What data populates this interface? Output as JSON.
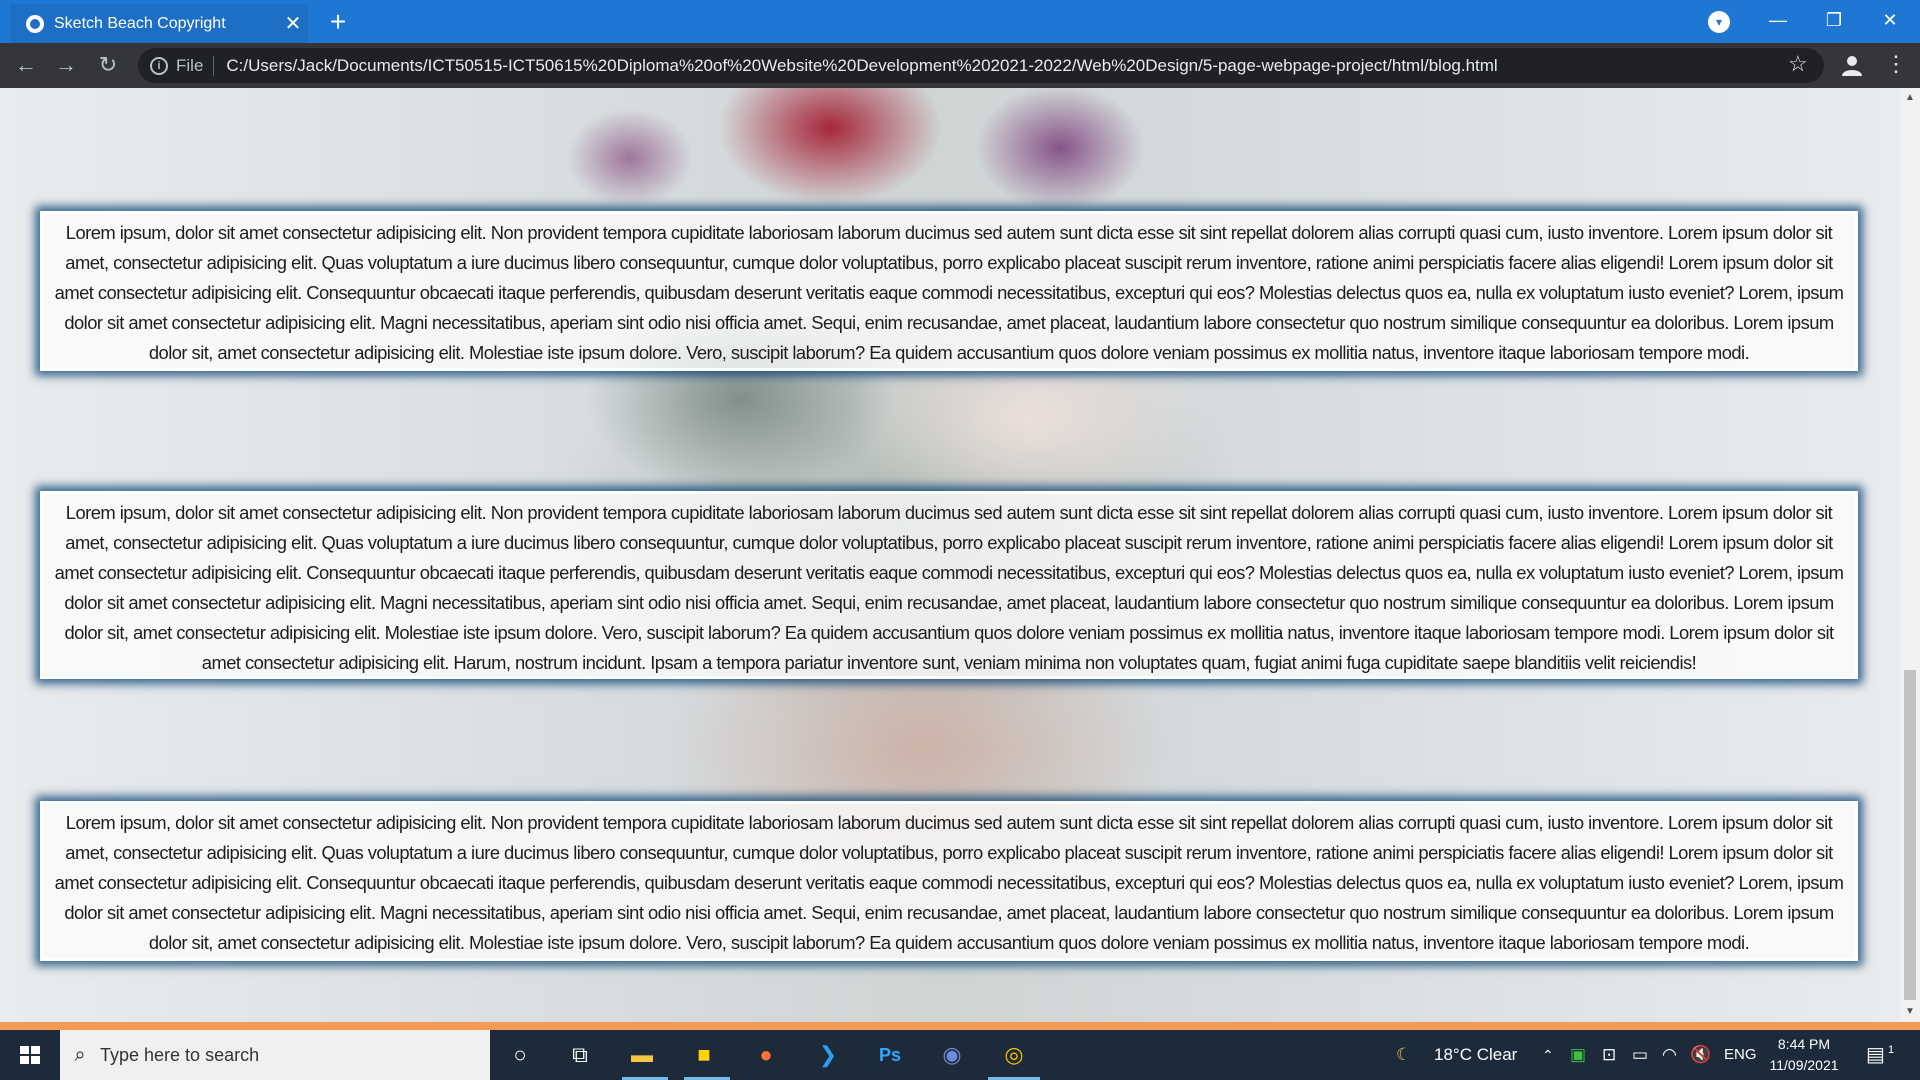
{
  "browser": {
    "tab_title": "Sketch Beach Copyright",
    "tab_close": "✕",
    "new_tab": "+",
    "scheme": "File",
    "url": "C:/Users/Jack/Documents/ICT50515-ICT50615%20Diploma%20of%20Website%20Development%202021-2022/Web%20Design/5-page-webpage-project/html/blog.html"
  },
  "content": {
    "paragraphs": [
      "Lorem ipsum, dolor sit amet consectetur adipisicing elit. Non provident tempora cupiditate laboriosam laborum ducimus sed autem sunt dicta esse sit sint repellat dolorem alias corrupti quasi cum, iusto inventore. Lorem ipsum dolor sit amet, consectetur adipisicing elit. Quas voluptatum a iure ducimus libero consequuntur, cumque dolor voluptatibus, porro explicabo placeat suscipit rerum inventore, ratione animi perspiciatis facere alias eligendi! Lorem ipsum dolor sit amet consectetur adipisicing elit. Consequuntur obcaecati itaque perferendis, quibusdam deserunt veritatis eaque commodi necessitatibus, excepturi qui eos? Molestias delectus quos ea, nulla ex voluptatum iusto eveniet? Lorem, ipsum dolor sit amet consectetur adipisicing elit. Magni necessitatibus, aperiam sint odio nisi officia amet. Sequi, enim recusandae, amet placeat, laudantium labore consectetur quo nostrum similique consequuntur ea doloribus. Lorem ipsum dolor sit, amet consectetur adipisicing elit. Molestiae iste ipsum dolore. Vero, suscipit laborum? Ea quidem accusantium quos dolore veniam possimus ex mollitia natus, inventore itaque laboriosam tempore modi.",
      "Lorem ipsum, dolor sit amet consectetur adipisicing elit. Non provident tempora cupiditate laboriosam laborum ducimus sed autem sunt dicta esse sit sint repellat dolorem alias corrupti quasi cum, iusto inventore. Lorem ipsum dolor sit amet, consectetur adipisicing elit. Quas voluptatum a iure ducimus libero consequuntur, cumque dolor voluptatibus, porro explicabo placeat suscipit rerum inventore, ratione animi perspiciatis facere alias eligendi! Lorem ipsum dolor sit amet consectetur adipisicing elit. Consequuntur obcaecati itaque perferendis, quibusdam deserunt veritatis eaque commodi necessitatibus, excepturi qui eos? Molestias delectus quos ea, nulla ex voluptatum iusto eveniet? Lorem, ipsum dolor sit amet consectetur adipisicing elit. Magni necessitatibus, aperiam sint odio nisi officia amet. Sequi, enim recusandae, amet placeat, laudantium labore consectetur quo nostrum similique consequuntur ea doloribus. Lorem ipsum dolor sit, amet consectetur adipisicing elit. Molestiae iste ipsum dolore. Vero, suscipit laborum? Ea quidem accusantium quos dolore veniam possimus ex mollitia natus, inventore itaque laboriosam tempore modi. Lorem ipsum dolor sit amet consectetur adipisicing elit. Harum, nostrum incidunt. Ipsam a tempora pariatur inventore sunt, veniam minima non voluptates quam, fugiat animi fuga cupiditate saepe blanditiis velit reiciendis!",
      "Lorem ipsum, dolor sit amet consectetur adipisicing elit. Non provident tempora cupiditate laboriosam laborum ducimus sed autem sunt dicta esse sit sint repellat dolorem alias corrupti quasi cum, iusto inventore. Lorem ipsum dolor sit amet, consectetur adipisicing elit. Quas voluptatum a iure ducimus libero consequuntur, cumque dolor voluptatibus, porro explicabo placeat suscipit rerum inventore, ratione animi perspiciatis facere alias eligendi! Lorem ipsum dolor sit amet consectetur adipisicing elit. Consequuntur obcaecati itaque perferendis, quibusdam deserunt veritatis eaque commodi necessitatibus, excepturi qui eos? Molestias delectus quos ea, nulla ex voluptatum iusto eveniet? Lorem, ipsum dolor sit amet consectetur adipisicing elit. Magni necessitatibus, aperiam sint odio nisi officia amet. Sequi, enim recusandae, amet placeat, laudantium labore consectetur quo nostrum similique consequuntur ea doloribus. Lorem ipsum dolor sit, amet consectetur adipisicing elit. Molestiae iste ipsum dolore. Vero, suscipit laborum? Ea quidem accusantium quos dolore veniam possimus ex mollitia natus, inventore itaque laboriosam tempore modi."
    ]
  },
  "taskbar": {
    "search_placeholder": "Type here to search",
    "weather": "18°C  Clear",
    "language": "ENG",
    "time": "8:44 PM",
    "date": "11/09/2021",
    "notification_count": "1"
  },
  "colors": {
    "chrome_titlebar": "#1f77d4",
    "chrome_toolbar": "#35363a",
    "box_glow": "#003c6e",
    "orange_strip": "#f39b54",
    "taskbar": "#1c2a3a"
  },
  "icons": [
    "globe-favicon-icon",
    "close-icon",
    "plus-icon",
    "back-arrow-icon",
    "forward-arrow-icon",
    "reload-icon",
    "info-icon",
    "star-icon",
    "account-icon",
    "kebab-menu-icon",
    "windows-start-icon",
    "search-icon",
    "cortana-icon",
    "task-view-icon",
    "file-explorer-icon",
    "sticky-notes-icon",
    "firefox-icon",
    "vscode-icon",
    "photoshop-icon",
    "discord-icon",
    "chrome-icon",
    "moon-icon",
    "chevron-up-icon",
    "notification-icon"
  ]
}
